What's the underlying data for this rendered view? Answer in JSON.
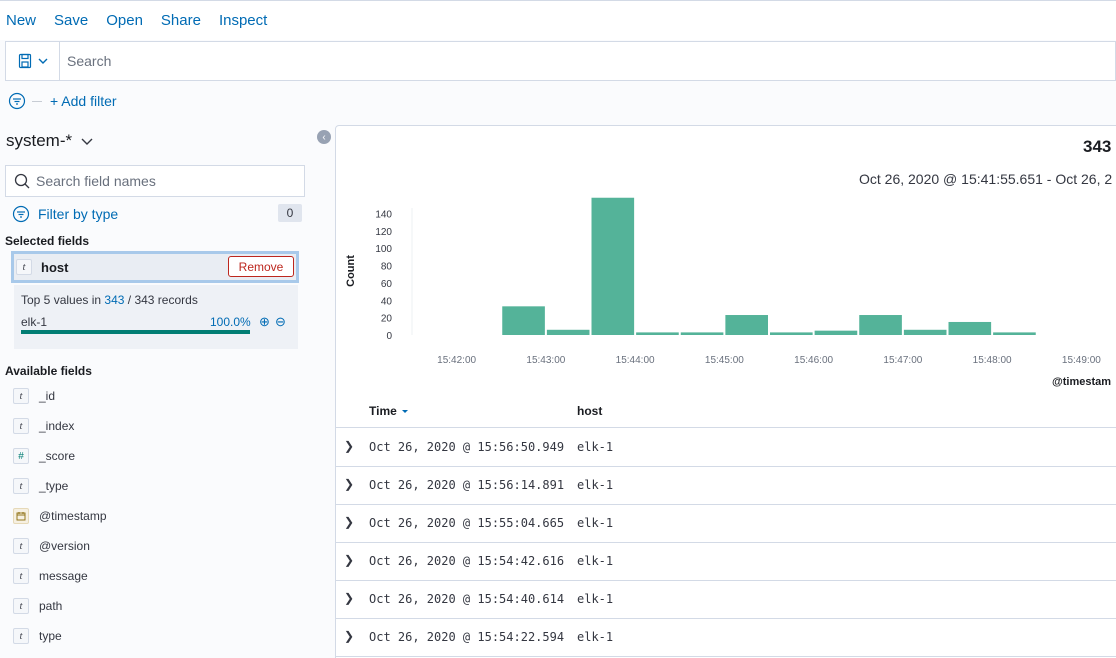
{
  "topmenu": {
    "items": [
      "New",
      "Save",
      "Open",
      "Share",
      "Inspect"
    ]
  },
  "query": {
    "placeholder": "Search"
  },
  "filters": {
    "add_label": "+ Add filter"
  },
  "sidebar": {
    "index_pattern": "system-*",
    "field_search_placeholder": "Search field names",
    "filter_by_type": "Filter by type",
    "filter_count": "0",
    "selected_title": "Selected fields",
    "selected": {
      "type": "t",
      "name": "host",
      "remove_label": "Remove"
    },
    "details": {
      "prefix": "Top 5 values in",
      "count": "343",
      "suffix": "/ 343 records",
      "value": "elk-1",
      "percent": "100.0%",
      "fraction": 1.0
    },
    "available_title": "Available fields",
    "available": [
      {
        "type": "t",
        "name": "_id"
      },
      {
        "type": "t",
        "name": "_index"
      },
      {
        "type": "#",
        "name": "_score"
      },
      {
        "type": "t",
        "name": "_type"
      },
      {
        "type": "calendar",
        "name": "@timestamp"
      },
      {
        "type": "t",
        "name": "@version"
      },
      {
        "type": "t",
        "name": "message"
      },
      {
        "type": "t",
        "name": "path"
      },
      {
        "type": "t",
        "name": "type"
      }
    ]
  },
  "main": {
    "hits": "343",
    "time_range": "Oct 26, 2020 @ 15:41:55.651 - Oct 26, 2",
    "table": {
      "columns": [
        "Time",
        "host"
      ],
      "rows": [
        {
          "time": "Oct 26, 2020 @ 15:56:50.949",
          "host": "elk-1"
        },
        {
          "time": "Oct 26, 2020 @ 15:56:14.891",
          "host": "elk-1"
        },
        {
          "time": "Oct 26, 2020 @ 15:55:04.665",
          "host": "elk-1"
        },
        {
          "time": "Oct 26, 2020 @ 15:54:42.616",
          "host": "elk-1"
        },
        {
          "time": "Oct 26, 2020 @ 15:54:40.614",
          "host": "elk-1"
        },
        {
          "time": "Oct 26, 2020 @ 15:54:22.594",
          "host": "elk-1"
        }
      ]
    }
  },
  "chart_data": {
    "type": "bar",
    "ylabel": "Count",
    "xlabel": "@timestam",
    "ylim": [
      0,
      160
    ],
    "yticks": [
      0,
      20,
      40,
      60,
      80,
      100,
      120,
      140
    ],
    "xticks": [
      "15:42:00",
      "15:43:00",
      "15:44:00",
      "15:45:00",
      "15:46:00",
      "15:47:00",
      "15:48:00",
      "15:49:00"
    ],
    "x_range": [
      "15:41:30",
      "15:49:30"
    ],
    "bucket": "30s",
    "categories": [
      "15:42:30",
      "15:43:00",
      "15:43:30",
      "15:44:00",
      "15:44:30",
      "15:45:00",
      "15:45:30",
      "15:46:00",
      "15:46:30",
      "15:47:00",
      "15:47:30",
      "15:48:00"
    ],
    "values": [
      33,
      6,
      158,
      3,
      3,
      23,
      3,
      5,
      23,
      6,
      15,
      3
    ],
    "color": "#54b399"
  }
}
